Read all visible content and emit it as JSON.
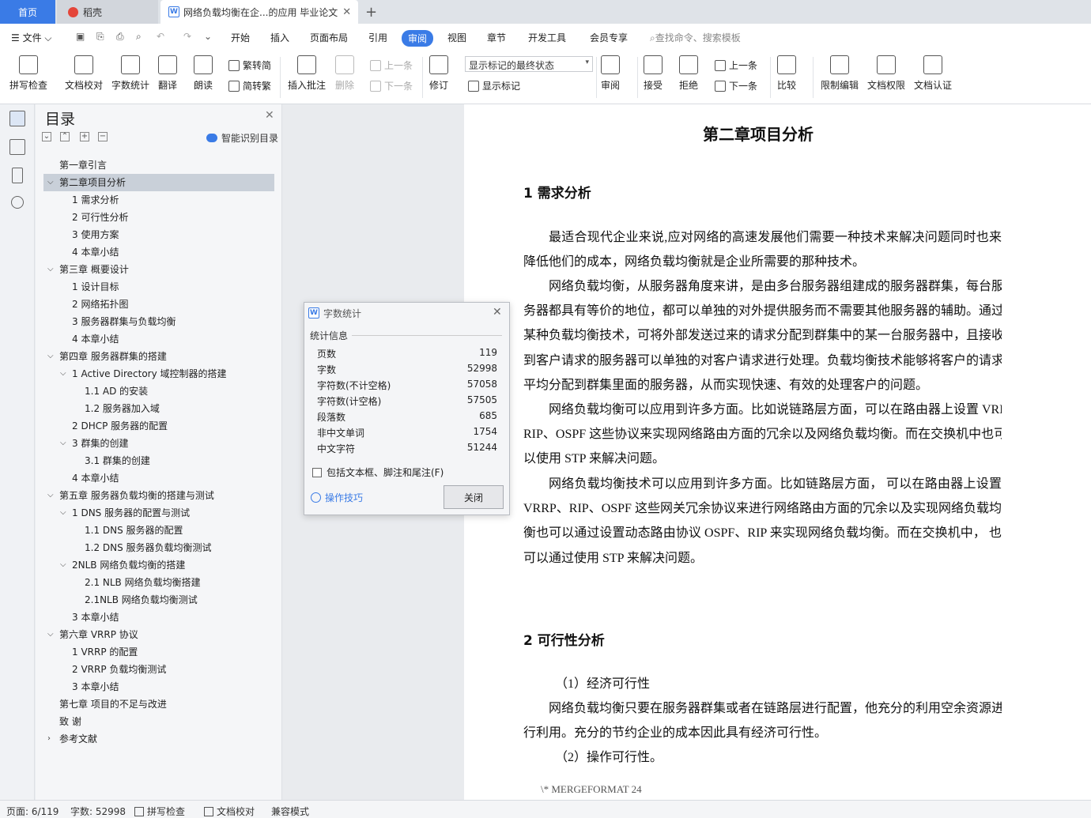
{
  "tabs": {
    "home": "首页",
    "daoke": "稻壳",
    "doc": "网络负载均衡在企...的应用 毕业论文"
  },
  "menu": {
    "file": "文件",
    "items": [
      "开始",
      "插入",
      "页面布局",
      "引用",
      "审阅",
      "视图",
      "章节",
      "开发工具",
      "会员专享"
    ],
    "search": "查找命令、搜索模板"
  },
  "ribbon": {
    "spell": "拼写检查",
    "proof": "文档校对",
    "wordcount": "字数统计",
    "translate": "翻译",
    "read": "朗读",
    "t2s": "繁转简",
    "s2t": "简转繁",
    "insert_comment": "插入批注",
    "delete": "删除",
    "prev_comment": "上一条",
    "next_comment": "下一条",
    "revise": "修订",
    "markup_select": "显示标记的最终状态",
    "show_markup": "显示标记",
    "review": "审阅",
    "accept": "接受",
    "reject": "拒绝",
    "prev_change": "上一条",
    "next_change": "下一条",
    "compare": "比较",
    "restrict": "限制编辑",
    "permission": "文档权限",
    "certify": "文档认证"
  },
  "toc": {
    "title": "目录",
    "smart": "智能识别目录",
    "items": [
      {
        "text": "第一章引言"
      },
      {
        "text": "第二章项目分析"
      },
      {
        "text": "1  需求分析"
      },
      {
        "text": "2  可行性分析"
      },
      {
        "text": "3  使用方案"
      },
      {
        "text": "4 本章小结"
      },
      {
        "text": "第三章  概要设计"
      },
      {
        "text": "1 设计目标"
      },
      {
        "text": "2 网络拓扑图"
      },
      {
        "text": "3 服务器群集与负载均衡"
      },
      {
        "text": "4 本章小结"
      },
      {
        "text": "第四章  服务器群集的搭建"
      },
      {
        "text": "1    Active Directory 域控制器的搭建"
      },
      {
        "text": "1.1    AD 的安装"
      },
      {
        "text": "1.2  服务器加入域"
      },
      {
        "text": "2    DHCP 服务器的配置"
      },
      {
        "text": "3    群集的创建"
      },
      {
        "text": "3.1  群集的创建"
      },
      {
        "text": "4    本章小结"
      },
      {
        "text": "第五章  服务器负载均衡的搭建与测试"
      },
      {
        "text": "1    DNS 服务器的配置与测试"
      },
      {
        "text": "1.1    DNS 服务器的配置"
      },
      {
        "text": "1.2 DNS 服务器负载均衡测试"
      },
      {
        "text": "2NLB 网络负载均衡的搭建"
      },
      {
        "text": "2.1    NLB 网络负载均衡搭建"
      },
      {
        "text": "2.1NLB 网络负载均衡测试"
      },
      {
        "text": "3    本章小结"
      },
      {
        "text": "第六章  VRRP 协议"
      },
      {
        "text": "1 VRRP 的配置"
      },
      {
        "text": "2 VRRP 负载均衡测试"
      },
      {
        "text": "3  本章小结"
      },
      {
        "text": "第七章  项目的不足与改进"
      },
      {
        "text": "致    谢"
      },
      {
        "text": "参考文献"
      }
    ]
  },
  "doc": {
    "chapter_title": "第二章项目分析",
    "h1": "1  需求分析",
    "p1": [
      "最适合现代企业来说,应对网络的高速发展他们需要一种技术来解决问题同时也来",
      "降低他们的成本，网络负载均衡就是企业所需要的那种技术。"
    ],
    "p2": [
      "网络负载均衡，从服务器角度来讲，是由多台服务器组建成的服务器群集，每台服",
      "务器都具有等价的地位，都可以单独的对外提供服务而不需要其他服务器的辅助。通过",
      "某种负载均衡技术，可将外部发送过来的请求分配到群集中的某一台服务器中，且接收",
      "到客户请求的服务器可以单独的对客户请求进行处理。负载均衡技术能够将客户的请求",
      "平均分配到群集里面的服务器，从而实现快速、有效的处理客户的问题。"
    ],
    "p3": [
      "网络负载均衡可以应用到许多方面。比如说链路层方面，可以在路由器上设置 VRRP、",
      "RIP、OSPF 这些协议来实现网络路由方面的冗余以及网络负载均衡。而在交换机中也可",
      "以使用 STP 来解决问题。"
    ],
    "p4": [
      "网络负载均衡技术可以应用到许多方面。比如链路层方面，  可以在路由器上设置",
      "VRRP、RIP、OSPF 这些网关冗余协议来进行网络路由方面的冗余以及实现网络负载均",
      "衡也可以通过设置动态路由协议 OSPF、RIP 来实现网络负载均衡。而在交换机中，  也",
      "可以通过使用 STP 来解决问题。"
    ],
    "h2": "2  可行性分析",
    "p5a": "（1）经济可行性",
    "p5": [
      "网络负载均衡只要在服务器群集或者在链路层进行配置，他充分的利用空余资源进",
      "行利用。充分的节约企业的成本因此具有经济可行性。"
    ],
    "p6a": "（2）操作可行性。",
    "footer": "\\* MERGEFORMAT 24"
  },
  "dialog": {
    "title": "字数统计",
    "section": "统计信息",
    "rows": [
      {
        "label": "页数",
        "value": "119"
      },
      {
        "label": "字数",
        "value": "52998"
      },
      {
        "label": "字符数(不计空格)",
        "value": "57058"
      },
      {
        "label": "字符数(计空格)",
        "value": "57505"
      },
      {
        "label": "段落数",
        "value": "685"
      },
      {
        "label": "非中文单词",
        "value": "1754"
      },
      {
        "label": "中文字符",
        "value": "51244"
      }
    ],
    "checkbox": "包括文本框、脚注和尾注(F)",
    "tips": "操作技巧",
    "close": "关闭"
  },
  "status": {
    "page": "页面: 6/119",
    "words": "字数: 52998",
    "spell": "拼写检查",
    "proof": "文档校对",
    "compat": "兼容模式"
  },
  "colors": {
    "accent": "#3a7be6"
  }
}
